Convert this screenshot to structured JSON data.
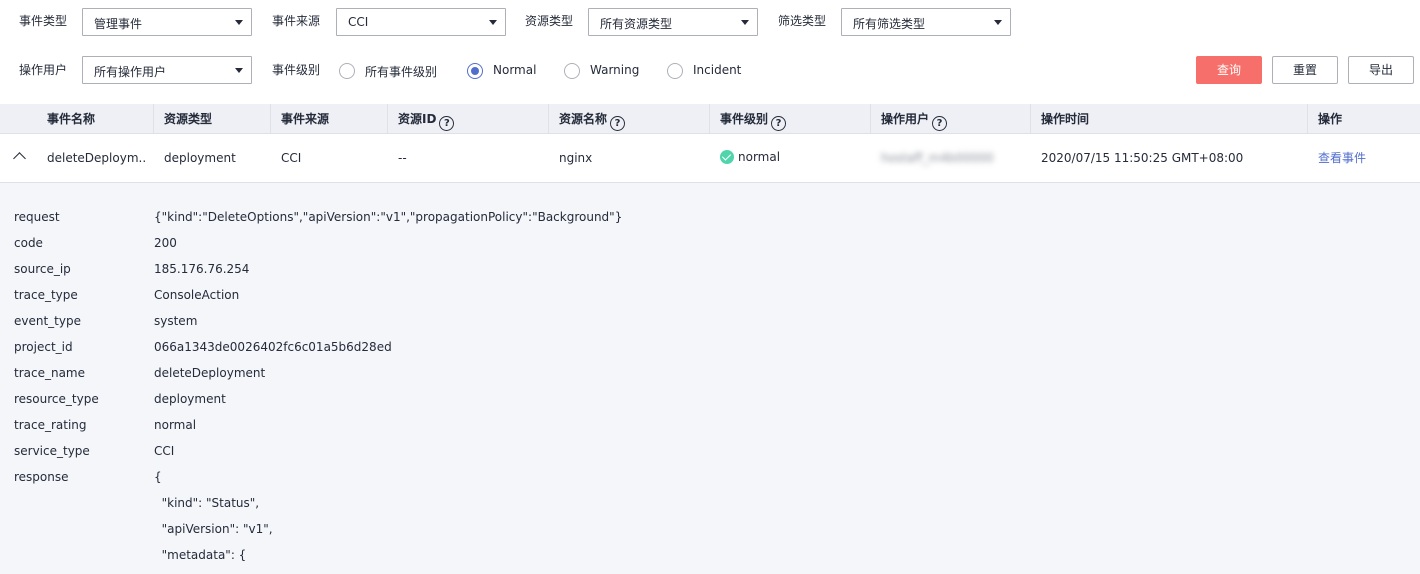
{
  "filters": {
    "event_type": {
      "label": "事件类型",
      "value": "管理事件"
    },
    "event_source": {
      "label": "事件来源",
      "value": "CCI"
    },
    "resource_type": {
      "label": "资源类型",
      "value": "所有资源类型"
    },
    "filter_type": {
      "label": "筛选类型",
      "value": "所有筛选类型"
    },
    "operator": {
      "label": "操作用户",
      "value": "所有操作用户"
    },
    "level": {
      "label": "事件级别",
      "options": [
        "所有事件级别",
        "Normal",
        "Warning",
        "Incident"
      ],
      "selected": "Normal"
    }
  },
  "buttons": {
    "query": "查询",
    "reset": "重置",
    "export": "导出"
  },
  "colors": {
    "primary": "#f66f6a",
    "link": "#526ecc",
    "ok": "#50d4ab"
  },
  "table": {
    "columns": [
      "事件名称",
      "资源类型",
      "事件来源",
      "资源ID",
      "资源名称",
      "事件级别",
      "操作用户",
      "操作时间",
      "操作"
    ],
    "row": {
      "event_name": "deleteDeploym...",
      "resource_type": "deployment",
      "event_source": "CCI",
      "resource_id": "--",
      "resource_name": "nginx",
      "level": "normal",
      "operator": "hostaff_m4b00000",
      "time": "2020/07/15 11:50:25 GMT+08:00",
      "action": "查看事件"
    }
  },
  "detail": [
    {
      "key": "request",
      "value": "{\"kind\":\"DeleteOptions\",\"apiVersion\":\"v1\",\"propagationPolicy\":\"Background\"}"
    },
    {
      "key": "code",
      "value": "200"
    },
    {
      "key": "source_ip",
      "value": "185.176.76.254"
    },
    {
      "key": "trace_type",
      "value": "ConsoleAction"
    },
    {
      "key": "event_type",
      "value": "system"
    },
    {
      "key": "project_id",
      "value": "066a1343de0026402fc6c01a5b6d28ed"
    },
    {
      "key": "trace_name",
      "value": "deleteDeployment"
    },
    {
      "key": "resource_type",
      "value": "deployment"
    },
    {
      "key": "trace_rating",
      "value": "normal"
    },
    {
      "key": "service_type",
      "value": "CCI"
    },
    {
      "key": "response",
      "value": "{"
    }
  ],
  "response_lines": [
    "  \"kind\": \"Status\",",
    "  \"apiVersion\": \"v1\",",
    "  \"metadata\": {"
  ]
}
